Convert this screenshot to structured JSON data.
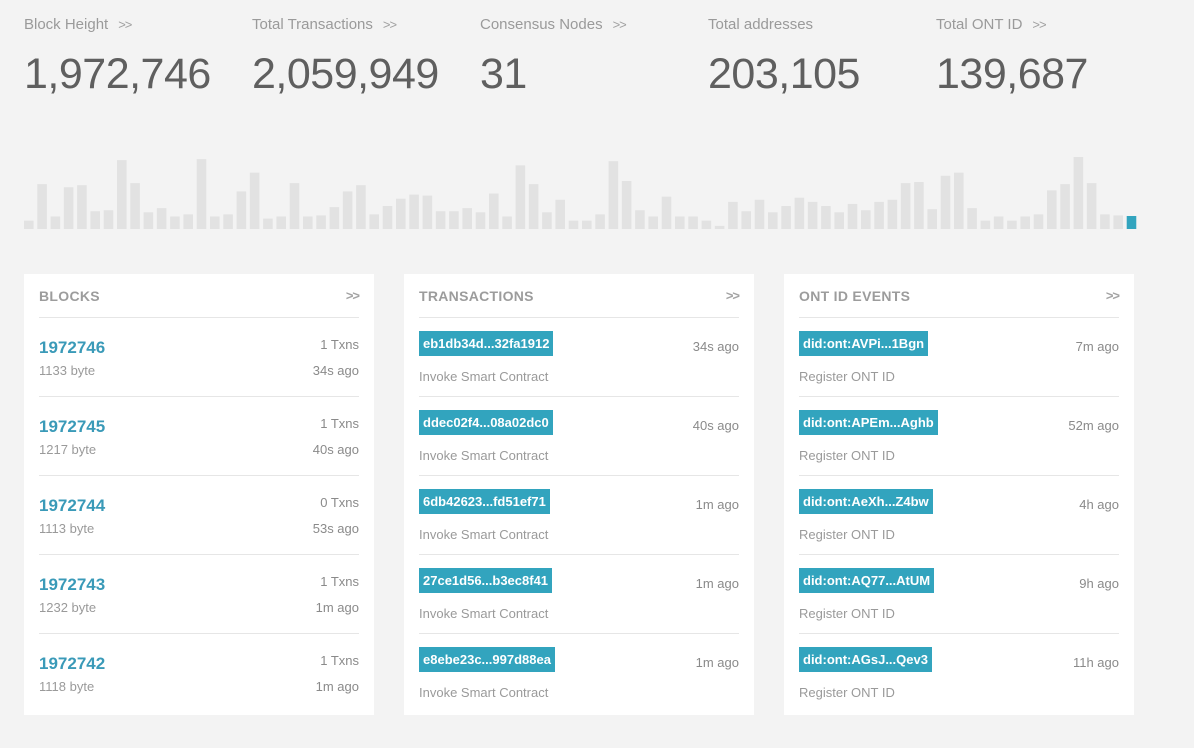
{
  "stats": [
    {
      "label": "Block Height",
      "arrow": ">>",
      "value": "1,972,746"
    },
    {
      "label": "Total Transactions",
      "arrow": ">>",
      "value": "2,059,949"
    },
    {
      "label": "Consensus Nodes",
      "arrow": ">>",
      "value": "31"
    },
    {
      "label": "Total addresses",
      "arrow": "",
      "value": "203,105"
    },
    {
      "label": "Total ONT ID",
      "arrow": ">>",
      "value": "139,687"
    }
  ],
  "chart_data": {
    "type": "bar",
    "title": "",
    "xlabel": "",
    "ylabel": "",
    "grid": false,
    "values": [
      8,
      43,
      12,
      40,
      42,
      17,
      18,
      66,
      44,
      16,
      20,
      12,
      14,
      67,
      12,
      14,
      36,
      54,
      10,
      12,
      44,
      12,
      13,
      21,
      36,
      42,
      14,
      22,
      29,
      33,
      32,
      17,
      17,
      20,
      16,
      34,
      12,
      61,
      43,
      16,
      28,
      8,
      8,
      14,
      65,
      46,
      18,
      12,
      31,
      12,
      12,
      8,
      3,
      26,
      17,
      28,
      16,
      22,
      30,
      26,
      22,
      16,
      24,
      18,
      26,
      28,
      44,
      45,
      19,
      51,
      54,
      20,
      8,
      12,
      8,
      12,
      14,
      37,
      43,
      69,
      44,
      14,
      13
    ],
    "highlight_last": true,
    "highlight_color": "#32a4be",
    "bar_color": "#e2e2e2"
  },
  "blocks_panel": {
    "title": "BLOCKS",
    "more": ">>",
    "rows": [
      {
        "height": "1972746",
        "size": "1133 byte",
        "txns": "1 Txns",
        "time": "34s ago"
      },
      {
        "height": "1972745",
        "size": "1217 byte",
        "txns": "1 Txns",
        "time": "40s ago"
      },
      {
        "height": "1972744",
        "size": "1113 byte",
        "txns": "0 Txns",
        "time": "53s ago"
      },
      {
        "height": "1972743",
        "size": "1232 byte",
        "txns": "1 Txns",
        "time": "1m ago"
      },
      {
        "height": "1972742",
        "size": "1118 byte",
        "txns": "1 Txns",
        "time": "1m ago"
      }
    ]
  },
  "transactions_panel": {
    "title": "TRANSACTIONS",
    "more": ">>",
    "rows": [
      {
        "hash": "eb1db34d...32fa1912",
        "desc": "Invoke Smart Contract",
        "time": "34s ago"
      },
      {
        "hash": "ddec02f4...08a02dc0",
        "desc": "Invoke Smart Contract",
        "time": "40s ago"
      },
      {
        "hash": "6db42623...fd51ef71",
        "desc": "Invoke Smart Contract",
        "time": "1m ago"
      },
      {
        "hash": "27ce1d56...b3ec8f41",
        "desc": "Invoke Smart Contract",
        "time": "1m ago"
      },
      {
        "hash": "e8ebe23c...997d88ea",
        "desc": "Invoke Smart Contract",
        "time": "1m ago"
      }
    ]
  },
  "ontid_panel": {
    "title": "ONT ID EVENTS",
    "more": ">>",
    "rows": [
      {
        "id": "did:ont:AVPi...1Bgn",
        "desc": "Register ONT ID",
        "time": "7m ago"
      },
      {
        "id": "did:ont:APEm...Aghb",
        "desc": "Register ONT ID",
        "time": "52m ago"
      },
      {
        "id": "did:ont:AeXh...Z4bw",
        "desc": "Register ONT ID",
        "time": "4h ago"
      },
      {
        "id": "did:ont:AQ77...AtUM",
        "desc": "Register ONT ID",
        "time": "9h ago"
      },
      {
        "id": "did:ont:AGsJ...Qev3",
        "desc": "Register ONT ID",
        "time": "11h ago"
      }
    ]
  }
}
